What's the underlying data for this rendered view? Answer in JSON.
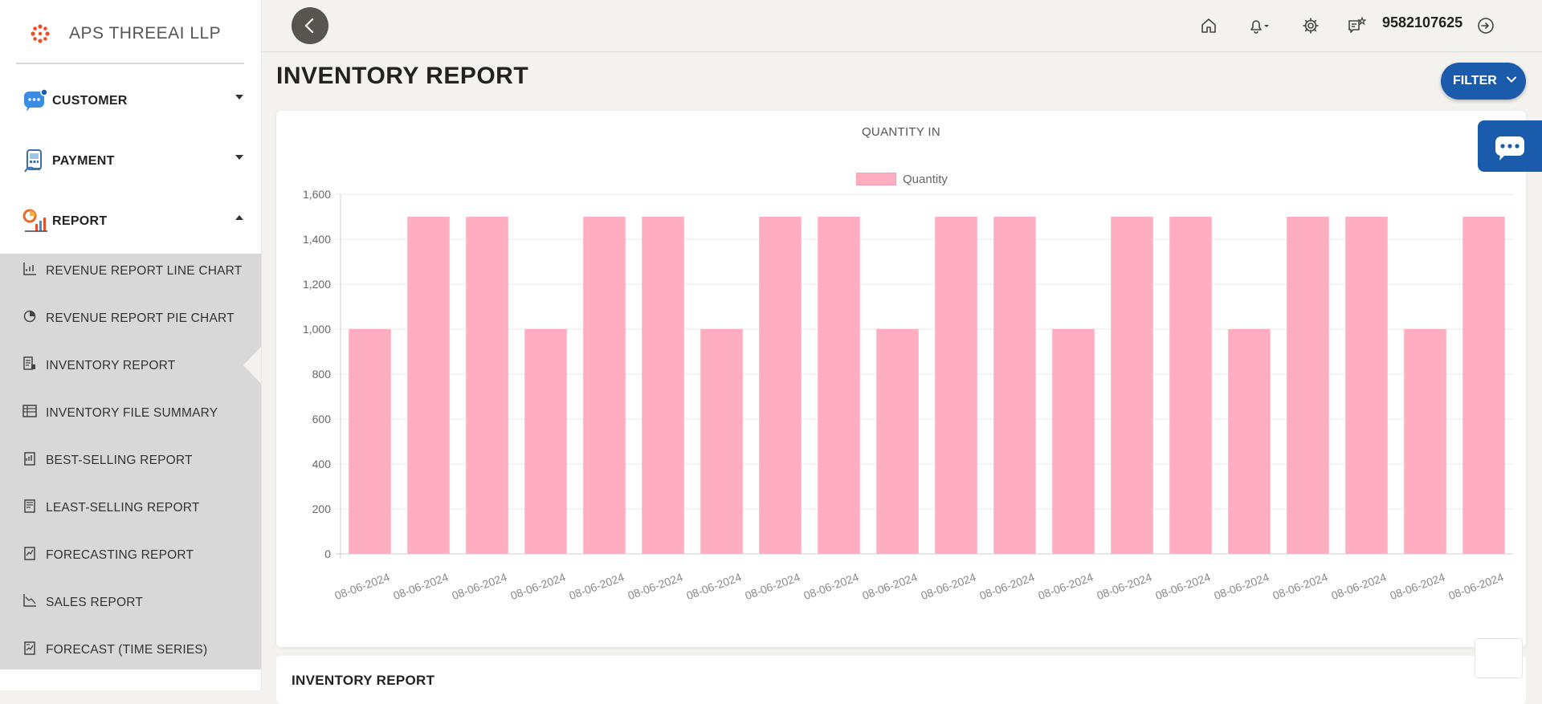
{
  "brand": {
    "name": "APS THREEAI LLP"
  },
  "sidebar": {
    "groups": [
      {
        "label": "CUSTOMER",
        "icon": "chat-users-icon"
      },
      {
        "label": "PAYMENT",
        "icon": "payment-icon"
      },
      {
        "label": "REPORT",
        "icon": "report-icon"
      }
    ],
    "report_items": [
      {
        "label": "REVENUE REPORT LINE CHART",
        "icon": "line-chart-icon"
      },
      {
        "label": "REVENUE REPORT PIE CHART",
        "icon": "pie-chart-icon"
      },
      {
        "label": "INVENTORY REPORT",
        "icon": "inventory-icon",
        "active": true
      },
      {
        "label": "INVENTORY FILE SUMMARY",
        "icon": "file-summary-icon"
      },
      {
        "label": "BEST-SELLING REPORT",
        "icon": "best-selling-icon"
      },
      {
        "label": "LEAST-SELLING REPORT",
        "icon": "least-selling-icon"
      },
      {
        "label": "FORECASTING REPORT",
        "icon": "forecasting-icon"
      },
      {
        "label": "SALES REPORT",
        "icon": "sales-icon"
      },
      {
        "label": "FORECAST (TIME SERIES)",
        "icon": "time-series-icon"
      }
    ]
  },
  "topbar": {
    "phone": "9582107625"
  },
  "main": {
    "title": "INVENTORY REPORT",
    "filter_label": "FILTER",
    "table_title": "INVENTORY REPORT"
  },
  "colors": {
    "accent": "#1a5bab",
    "bar": "#ffadc1",
    "sidebar_sub": "#d8d8d8"
  },
  "chart_data": {
    "type": "bar",
    "title": "QUANTITY IN",
    "legend": "top",
    "grid": true,
    "ylim": [
      0,
      1600
    ],
    "yticks": [
      "0",
      "200",
      "400",
      "600",
      "800",
      "1,000",
      "1,200",
      "1,400",
      "1,600"
    ],
    "categories": [
      "08-06-2024",
      "08-06-2024",
      "08-06-2024",
      "08-06-2024",
      "08-06-2024",
      "08-06-2024",
      "08-06-2024",
      "08-06-2024",
      "08-06-2024",
      "08-06-2024",
      "08-06-2024",
      "08-06-2024",
      "08-06-2024",
      "08-06-2024",
      "08-06-2024",
      "08-06-2024",
      "08-06-2024",
      "08-06-2024",
      "08-06-2024",
      "08-06-2024"
    ],
    "series": [
      {
        "name": "Quantity",
        "values": [
          1000,
          1500,
          1500,
          1000,
          1500,
          1500,
          1000,
          1500,
          1500,
          1000,
          1500,
          1500,
          1000,
          1500,
          1500,
          1000,
          1500,
          1500,
          1000,
          1500
        ]
      }
    ]
  }
}
